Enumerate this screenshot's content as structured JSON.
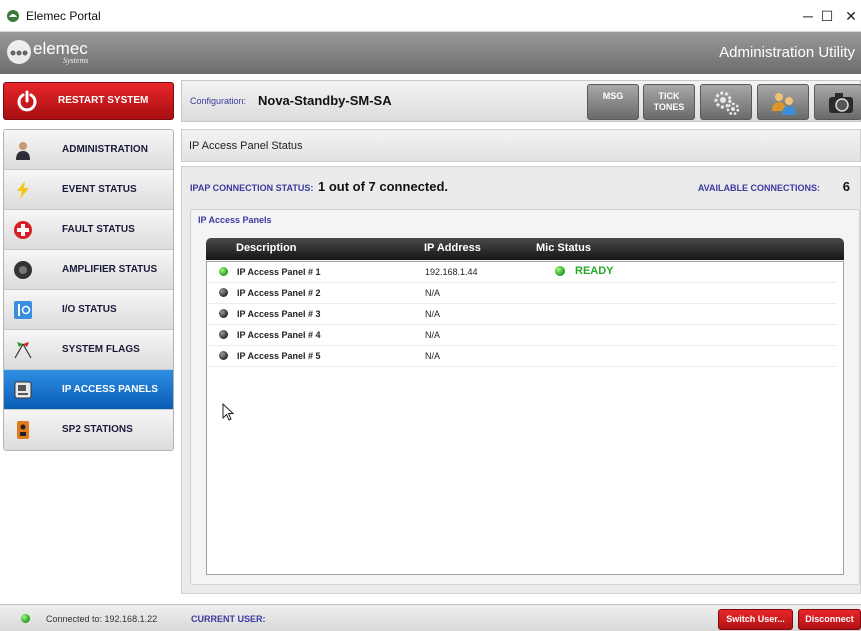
{
  "window": {
    "title": "Elemec Portal",
    "controls": {
      "minimize": "─",
      "maximize": "☐",
      "close": "✕"
    }
  },
  "header": {
    "logo_text": "elemec",
    "logo_subtext": "Systems",
    "app_title": "Administration Utility"
  },
  "sidebar": {
    "restart_label": "RESTART SYSTEM",
    "items": [
      {
        "label": "ADMINISTRATION",
        "icon": "admin-person-icon",
        "active": false
      },
      {
        "label": "EVENT STATUS",
        "icon": "lightning-icon",
        "active": false
      },
      {
        "label": "FAULT STATUS",
        "icon": "red-cross-icon",
        "active": false
      },
      {
        "label": "AMPLIFIER STATUS",
        "icon": "speaker-icon",
        "active": false
      },
      {
        "label": "I/O STATUS",
        "icon": "io-switch-icon",
        "active": false
      },
      {
        "label": "SYSTEM FLAGS",
        "icon": "flags-icon",
        "active": false
      },
      {
        "label": "IP ACCESS PANELS",
        "icon": "panel-device-icon",
        "active": true
      },
      {
        "label": "SP2 STATIONS",
        "icon": "station-icon",
        "active": false
      }
    ]
  },
  "config": {
    "label": "Configuration:",
    "value": "Nova-Standby-SM-SA"
  },
  "toolbar": {
    "msg_label": "MSG",
    "tick_label_1": "TICK",
    "tick_label_2": "TONES",
    "icons": [
      "gears-icon",
      "users-icon",
      "camera-icon"
    ]
  },
  "section": {
    "title": "IP Access Panel Status"
  },
  "status_summary": {
    "connection_label": "IPAP CONNECTION STATUS:",
    "connection_value": "1 out of 7 connected.",
    "available_label": "AVAILABLE CONNECTIONS:",
    "available_value": "6"
  },
  "panels": {
    "title": "IP Access Panels",
    "columns": [
      "Description",
      "IP Address",
      "Mic Status"
    ],
    "rows": [
      {
        "description": "IP Access Panel # 1",
        "ip": "192.168.1.44",
        "status": "green",
        "mic": "READY"
      },
      {
        "description": "IP Access Panel # 2",
        "ip": "N/A",
        "status": "gray",
        "mic": ""
      },
      {
        "description": "IP Access Panel # 3",
        "ip": "N/A",
        "status": "gray",
        "mic": ""
      },
      {
        "description": "IP Access Panel # 4",
        "ip": "N/A",
        "status": "gray",
        "mic": ""
      },
      {
        "description": "IP Access Panel # 5",
        "ip": "N/A",
        "status": "gray",
        "mic": ""
      }
    ]
  },
  "statusbar": {
    "connected_text": "Connected to: 192.168.1.22",
    "user_label": "CURRENT USER:",
    "switch_user_label": "Switch User...",
    "disconnect_label": "Disconnect"
  },
  "colors": {
    "accent_red": "#d81e22",
    "active_blue": "#1672cc",
    "label_blue": "#3a3aa0",
    "ready_green": "#27a827"
  }
}
